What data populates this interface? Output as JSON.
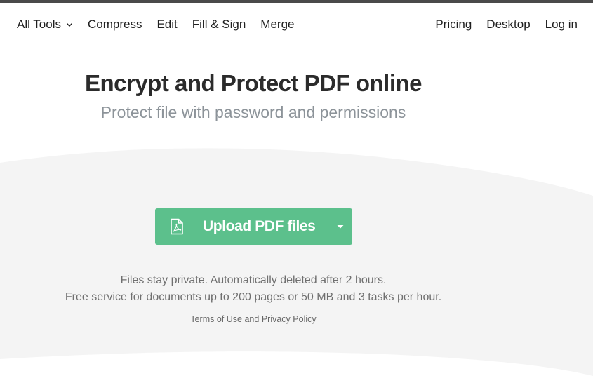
{
  "nav": {
    "left": [
      {
        "label": "All Tools",
        "has_dropdown": true
      },
      {
        "label": "Compress"
      },
      {
        "label": "Edit"
      },
      {
        "label": "Fill & Sign"
      },
      {
        "label": "Merge"
      }
    ],
    "right": [
      {
        "label": "Pricing"
      },
      {
        "label": "Desktop"
      },
      {
        "label": "Log in"
      }
    ]
  },
  "hero": {
    "title": "Encrypt and Protect PDF online",
    "subtitle": "Protect file with password and permissions"
  },
  "upload": {
    "label": "Upload PDF files",
    "icon": "pdf-file-icon",
    "dropdown_icon": "caret-down-icon"
  },
  "info": {
    "line1": "Files stay private. Automatically deleted after 2 hours.",
    "line2": "Free service for documents up to 200 pages or 50 MB and 3 tasks per hour."
  },
  "legal": {
    "terms": "Terms of Use",
    "and": "and",
    "privacy": "Privacy Policy"
  },
  "colors": {
    "accent": "#5cc08c",
    "background_band": "#f4f4f4",
    "top_stripe": "#4a4a4a"
  }
}
